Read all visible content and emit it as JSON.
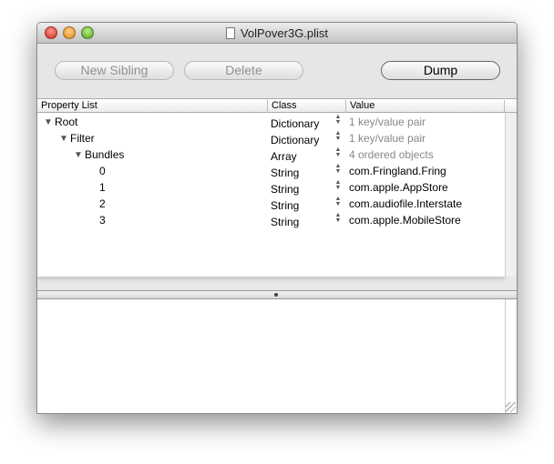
{
  "window": {
    "title": "VolPover3G.plist"
  },
  "toolbar": {
    "new_sibling": "New Sibling",
    "delete": "Delete",
    "dump": "Dump"
  },
  "columns": [
    "Property List",
    "Class",
    "Value"
  ],
  "rows": [
    {
      "key": "Root",
      "cls": "Dictionary",
      "value": "1 key/value pair",
      "depth": 0,
      "expanded": true,
      "dim": true
    },
    {
      "key": "Filter",
      "cls": "Dictionary",
      "value": "1 key/value pair",
      "depth": 1,
      "expanded": true,
      "dim": true
    },
    {
      "key": "Bundles",
      "cls": "Array",
      "value": "4 ordered objects",
      "depth": 2,
      "expanded": true,
      "dim": true
    },
    {
      "key": "0",
      "cls": "String",
      "value": "com.Fringland.Fring",
      "depth": 3,
      "dim": false
    },
    {
      "key": "1",
      "cls": "String",
      "value": "com.apple.AppStore",
      "depth": 3,
      "dim": false
    },
    {
      "key": "2",
      "cls": "String",
      "value": "com.audiofile.Interstate",
      "depth": 3,
      "dim": false
    },
    {
      "key": "3",
      "cls": "String",
      "value": "com.apple.MobileStore",
      "depth": 3,
      "dim": false
    }
  ]
}
